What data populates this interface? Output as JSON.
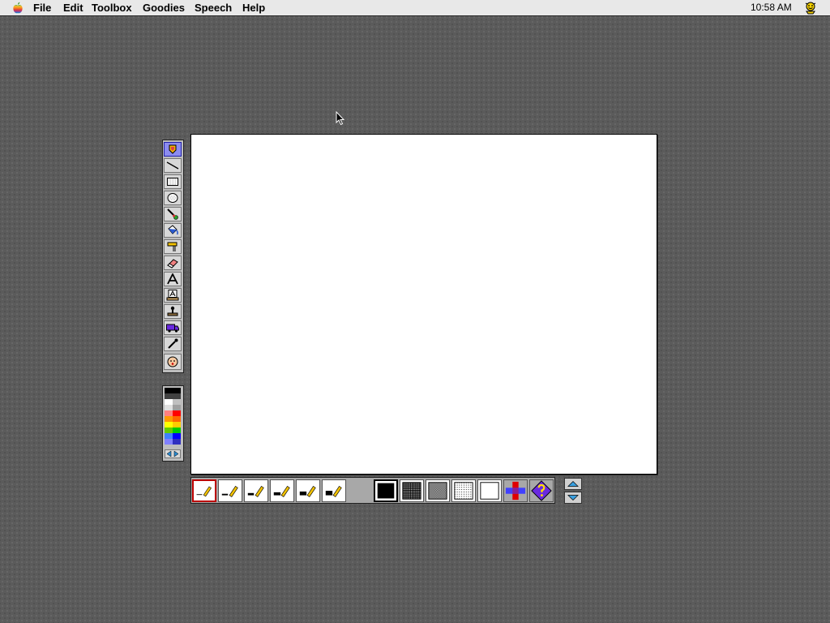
{
  "menubar": {
    "apple_icon": "apple-logo-icon",
    "menus": [
      {
        "label": "File"
      },
      {
        "label": "Edit"
      },
      {
        "label": "Toolbox"
      },
      {
        "label": "Goodies"
      },
      {
        "label": "Speech"
      },
      {
        "label": "Help"
      }
    ],
    "clock": "10:58 AM",
    "app_icon": "kid-pix-character-icon"
  },
  "tools": [
    {
      "name": "pencil-tool",
      "icon": "pencil-icon",
      "selected": true
    },
    {
      "name": "line-tool",
      "icon": "line-icon"
    },
    {
      "name": "rectangle-tool",
      "icon": "rectangle-icon"
    },
    {
      "name": "oval-tool",
      "icon": "oval-icon"
    },
    {
      "name": "paintbrush-tool",
      "icon": "paintbrush-icon"
    },
    {
      "name": "paint-bucket-tool",
      "icon": "paint-bucket-icon"
    },
    {
      "name": "electric-mixer-tool",
      "icon": "mixer-icon"
    },
    {
      "name": "eraser-tool",
      "icon": "eraser-icon"
    },
    {
      "name": "text-tool",
      "icon": "text-icon"
    },
    {
      "name": "alphabet-stamp-tool",
      "icon": "alphabet-stamp-icon"
    },
    {
      "name": "rubber-stamp-tool",
      "icon": "rubber-stamp-icon"
    },
    {
      "name": "moving-van-tool",
      "icon": "moving-van-icon"
    },
    {
      "name": "eyedropper-tool",
      "icon": "eyedropper-icon"
    },
    {
      "name": "undo-guy-tool",
      "icon": "undo-face-icon"
    }
  ],
  "colors": {
    "swatches": [
      "#000000",
      "#404040",
      "#ffffff",
      "#c0c0c0",
      "#ff8080",
      "#ff0000",
      "#ff9900",
      "#ffff00",
      "#66cc00",
      "#00cc00",
      "#4080ff",
      "#0000ff"
    ],
    "scroll_icon": "palette-scroll-arrows-icon"
  },
  "line_widths": [
    "pencil-line-width-1",
    "pencil-line-width-2",
    "pencil-line-width-3",
    "pencil-line-width-4",
    "pencil-line-width-5",
    "pencil-line-width-6"
  ],
  "patterns": [
    "solid-black-pattern",
    "dark-dither-pattern",
    "medium-dither-pattern",
    "light-dither-pattern",
    "white-pattern",
    "rainbow-cross-pattern",
    "random-question-pattern"
  ],
  "scroll_buttons": {
    "up_icon": "triangle-up-icon",
    "down_icon": "triangle-down-icon"
  }
}
